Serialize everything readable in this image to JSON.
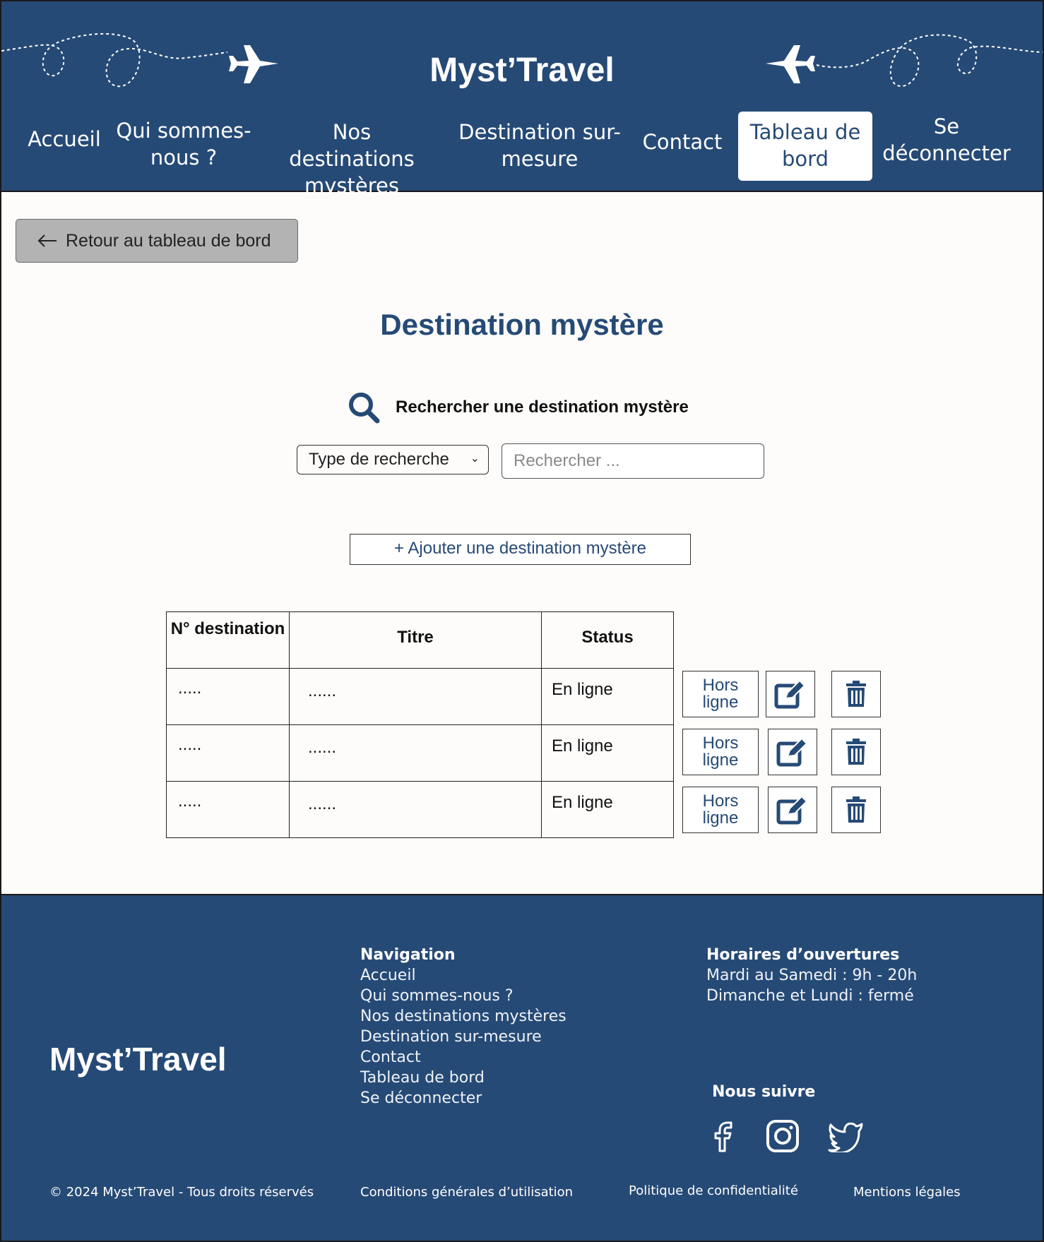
{
  "colors": {
    "brand": "#264a76",
    "main_bg": "#fdfcfa",
    "back_button_bg": "#b3b3b3"
  },
  "header": {
    "brand": "Myst’Travel",
    "nav": [
      {
        "label": "Accueil"
      },
      {
        "label": "Qui sommes-nous ?"
      },
      {
        "label": "Nos destinations mystères"
      },
      {
        "label": "Destination sur-mesure"
      },
      {
        "label": "Contact"
      },
      {
        "label": "Tableau de bord",
        "active": true
      },
      {
        "label": "Se déconnecter"
      }
    ]
  },
  "main": {
    "back_button": "Retour au tableau de bord",
    "title": "Destination mystère",
    "search": {
      "label": "Rechercher une destination mystère",
      "type_select": "Type de recherche",
      "placeholder": "Rechercher ..."
    },
    "add_button": "+ Ajouter une destination mystère",
    "table": {
      "headers": [
        "N° destination",
        "Titre",
        "Status"
      ],
      "rows": [
        {
          "num": ".....",
          "titre": "......",
          "status": "En ligne",
          "action": "Hors ligne"
        },
        {
          "num": ".....",
          "titre": "......",
          "status": "En ligne",
          "action": "Hors ligne"
        },
        {
          "num": ".....",
          "titre": "......",
          "status": "En ligne",
          "action": "Hors ligne"
        }
      ]
    }
  },
  "footer": {
    "brand": "Myst’Travel",
    "navigation": {
      "title": "Navigation",
      "links": [
        "Accueil",
        "Qui sommes-nous ?",
        "Nos destinations mystères",
        "Destination sur-mesure",
        "Contact",
        "Tableau de bord",
        "Se déconnecter"
      ]
    },
    "hours": {
      "title": "Horaires d’ouvertures",
      "lines": [
        "Mardi au Samedi : 9h - 20h",
        "Dimanche et Lundi : fermé"
      ]
    },
    "follow": "Nous suivre",
    "social_icons": [
      "facebook-icon",
      "instagram-icon",
      "twitter-icon"
    ],
    "copyright": "© 2024 Myst’Travel - Tous droits réservés",
    "legal_links": [
      "Conditions générales d’utilisation",
      "Politique de confidentialité",
      "Mentions légales"
    ]
  }
}
